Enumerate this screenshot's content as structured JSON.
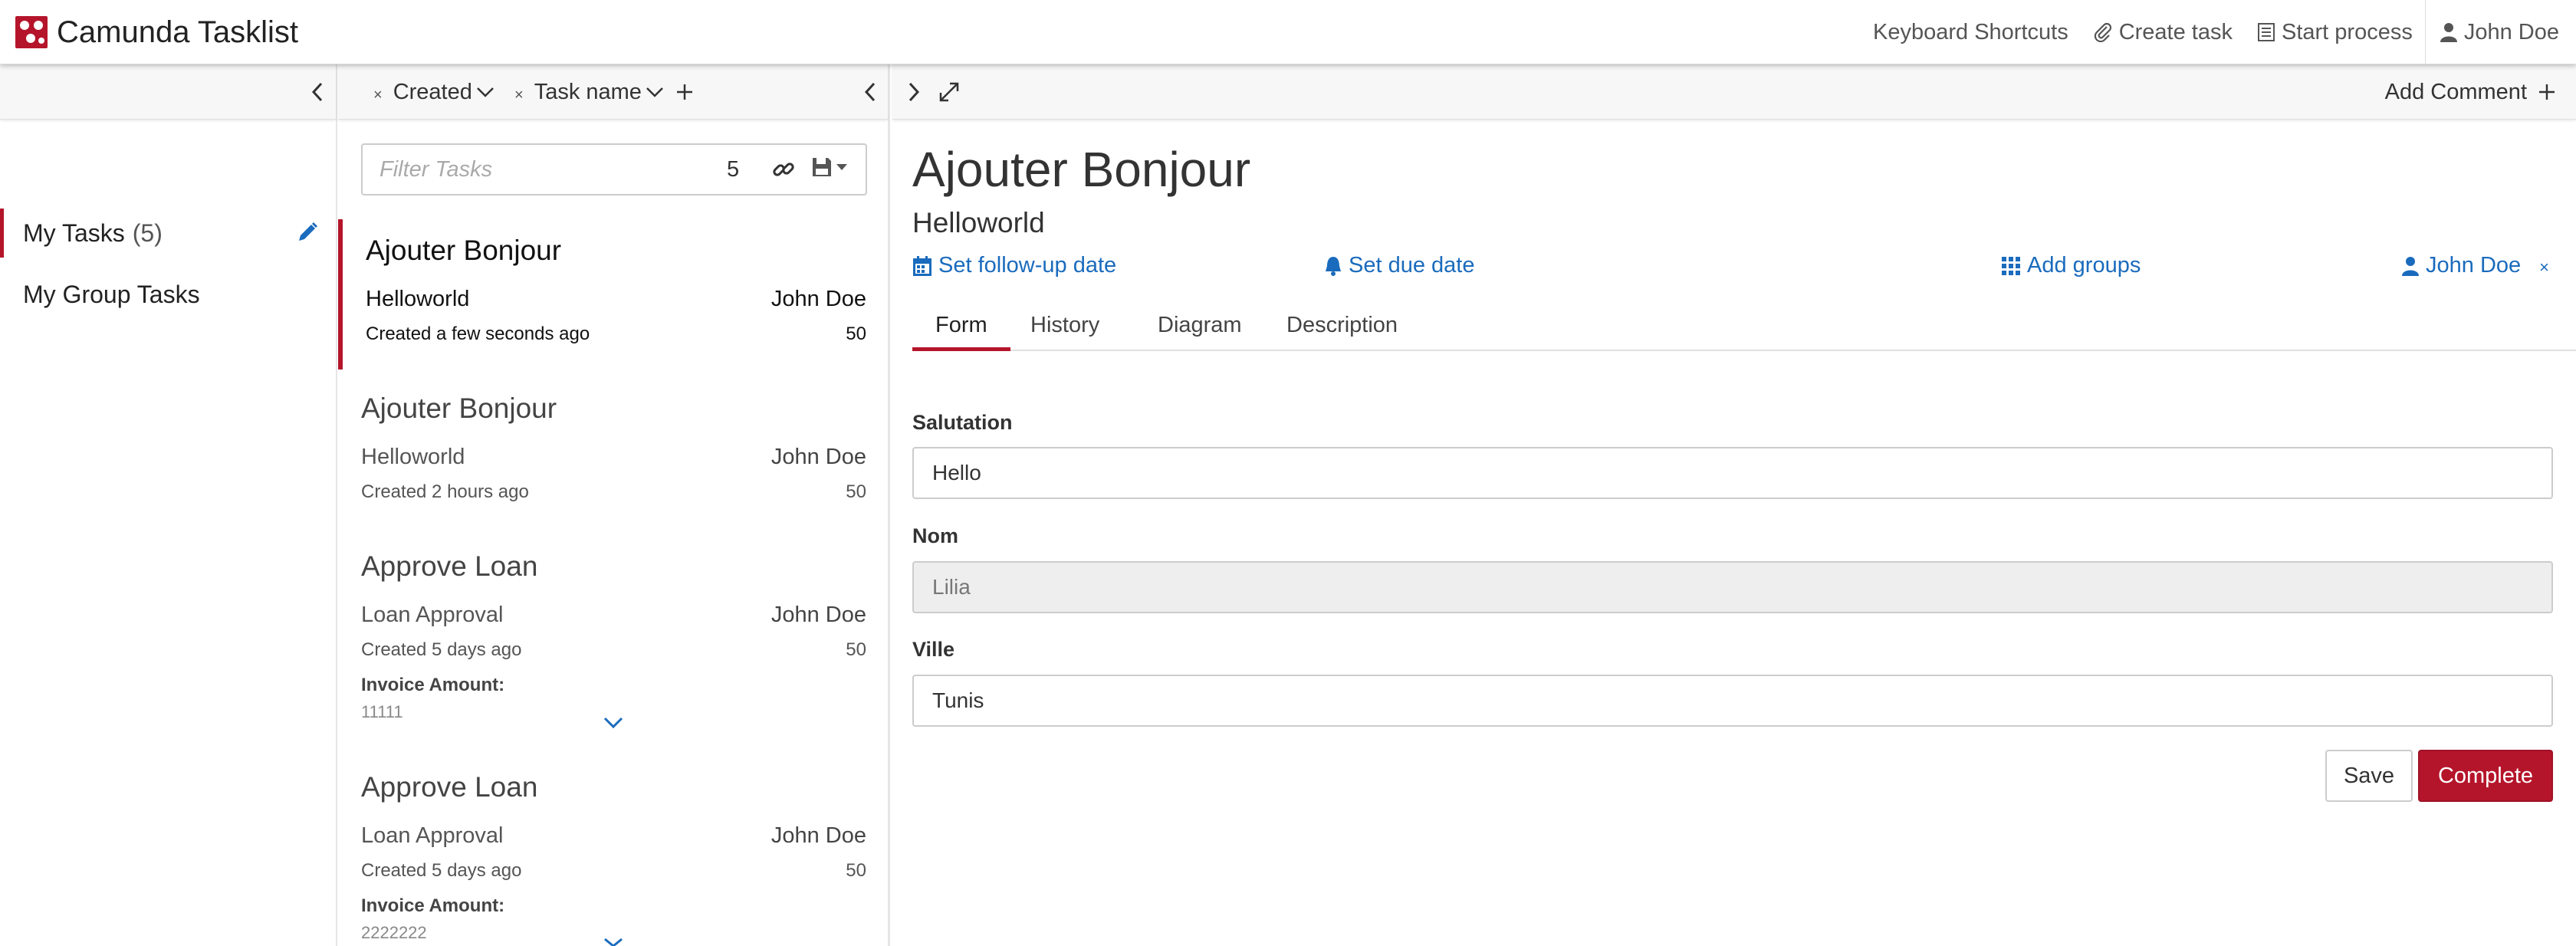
{
  "app": {
    "title": "Camunda Tasklist"
  },
  "nav": {
    "keyboard_shortcuts": "Keyboard Shortcuts",
    "create_task": "Create task",
    "start_process": "Start process",
    "user": "John Doe"
  },
  "filters": {
    "items": [
      {
        "label": "My Tasks",
        "count": "(5)"
      },
      {
        "label": "My Group Tasks"
      }
    ]
  },
  "sorting": {
    "items": [
      {
        "label": "Created"
      },
      {
        "label": "Task name"
      }
    ]
  },
  "search": {
    "placeholder": "Filter Tasks",
    "count": "5"
  },
  "tasks": [
    {
      "name": "Ajouter Bonjour",
      "process": "Helloworld",
      "assignee": "John Doe",
      "created": "Created a few seconds ago",
      "priority": "50"
    },
    {
      "name": "Ajouter Bonjour",
      "process": "Helloworld",
      "assignee": "John Doe",
      "created": "Created 2 hours ago",
      "priority": "50"
    },
    {
      "name": "Approve Loan",
      "process": "Loan Approval",
      "assignee": "John Doe",
      "created": "Created 5 days ago",
      "priority": "50",
      "var_label": "Invoice Amount:",
      "var_value": "11111"
    },
    {
      "name": "Approve Loan",
      "process": "Loan Approval",
      "assignee": "John Doe",
      "created": "Created 5 days ago",
      "priority": "50",
      "var_label": "Invoice Amount:",
      "var_value": "2222222"
    }
  ],
  "detail": {
    "add_comment": "Add Comment",
    "title": "Ajouter Bonjour",
    "subtitle": "Helloworld",
    "follow_up": "Set follow-up date",
    "due_date": "Set due date",
    "add_groups": "Add groups",
    "assignee": "John Doe",
    "tabs": [
      {
        "label": "Form"
      },
      {
        "label": "History"
      },
      {
        "label": "Diagram"
      },
      {
        "label": "Description"
      }
    ],
    "form": {
      "fields": [
        {
          "label": "Salutation",
          "value": "Hello"
        },
        {
          "label": "Nom",
          "value": "Lilia"
        },
        {
          "label": "Ville",
          "value": "Tunis"
        }
      ],
      "save": "Save",
      "complete": "Complete"
    }
  },
  "colors": {
    "accent": "#b5152b",
    "link": "#1a6bbd"
  },
  "icons": [
    "camunda-logo-icon",
    "keyboard-icon",
    "paperclip-icon",
    "list-icon",
    "user-icon",
    "chevron-left-icon",
    "chevron-right-icon",
    "chevron-down-icon",
    "expand-icon",
    "plus-icon",
    "pencil-icon",
    "link-icon",
    "floppy-icon",
    "calendar-icon",
    "bell-icon",
    "grid-icon",
    "close-icon"
  ]
}
